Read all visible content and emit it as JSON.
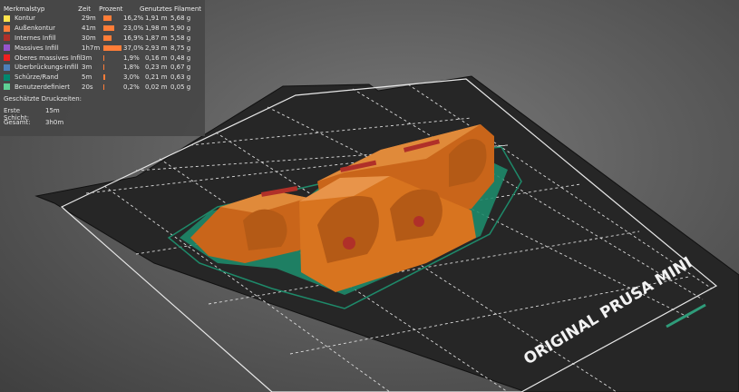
{
  "legend": {
    "header": {
      "type": "Merkmalstyp",
      "time": "Zeit",
      "percent": "Prozent",
      "filament": "Genutztes Filament"
    },
    "rows": [
      {
        "label": "Kontur",
        "time": "29m",
        "percent": "16,2%",
        "meters": "1,91 m",
        "grams": "5,68 g",
        "color": "#FFE44D",
        "bar_fraction": 0.162
      },
      {
        "label": "Außenkontur",
        "time": "41m",
        "percent": "23,0%",
        "meters": "1,98 m",
        "grams": "5,90 g",
        "color": "#FF7D38",
        "bar_fraction": 0.23
      },
      {
        "label": "Internes Infill",
        "time": "30m",
        "percent": "16,9%",
        "meters": "1,87 m",
        "grams": "5,58 g",
        "color": "#B03029",
        "bar_fraction": 0.169
      },
      {
        "label": "Massives Infill",
        "time": "1h7m",
        "percent": "37,0%",
        "meters": "2,93 m",
        "grams": "8,75 g",
        "color": "#9654CC",
        "bar_fraction": 0.37
      },
      {
        "label": "Oberes massives Infill",
        "time": "3m",
        "percent": "1,9%",
        "meters": "0,16 m",
        "grams": "0,48 g",
        "color": "#F02020",
        "bar_fraction": 0.019
      },
      {
        "label": "Überbrückungs-Infill",
        "time": "3m",
        "percent": "1,8%",
        "meters": "0,23 m",
        "grams": "0,67 g",
        "color": "#4D80BA",
        "bar_fraction": 0.018
      },
      {
        "label": "Schürze/Rand",
        "time": "5m",
        "percent": "3,0%",
        "meters": "0,21 m",
        "grams": "0,63 g",
        "color": "#00876E",
        "bar_fraction": 0.03
      },
      {
        "label": "Benutzerdefiniert",
        "time": "20s",
        "percent": "0,2%",
        "meters": "0,02 m",
        "grams": "0,05 g",
        "color": "#5ED194",
        "bar_fraction": 0.002
      }
    ],
    "estimate_title": "Geschätzte Druckzeiten:",
    "first_layer_label": "Erste Schicht:",
    "first_layer_value": "15m",
    "total_label": "Gesamt:",
    "total_value": "3h0m",
    "bar_color": "#FF7D38"
  },
  "bed": {
    "brand_text": "ORIGINAL PRUSA MINI"
  },
  "colors": {
    "model": "#D8741F",
    "skirt": "#1E8A6A",
    "bed": "#262626"
  }
}
